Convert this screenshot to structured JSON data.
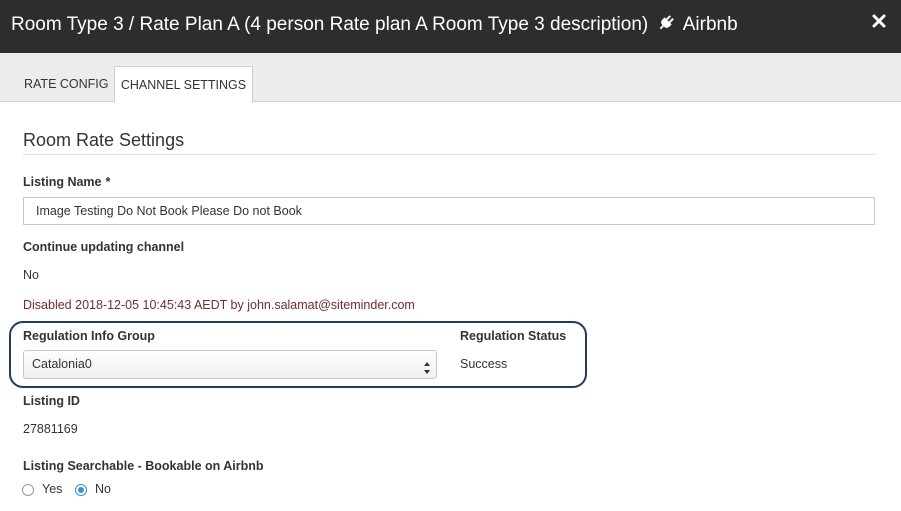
{
  "header": {
    "title": "Room Type 3 / Rate Plan A (4 person Rate plan A Room Type 3 description)",
    "channel": "Airbnb",
    "close_icon": "close-icon",
    "plug_icon": "plug-icon"
  },
  "tabs": [
    {
      "label": "RATE CONFIG",
      "active": false
    },
    {
      "label": "CHANNEL SETTINGS",
      "active": true
    }
  ],
  "section": {
    "title": "Room Rate Settings"
  },
  "listing_name": {
    "label": "Listing Name",
    "required_mark": "*",
    "value": "Image Testing Do Not Book Please Do not Book"
  },
  "continue_updating": {
    "label": "Continue updating channel",
    "value": "No",
    "note": "Disabled 2018-12-05 10:45:43 AEDT by john.salamat@siteminder.com"
  },
  "regulation": {
    "group_label": "Regulation Info Group",
    "group_value": "Catalonia0",
    "status_label": "Regulation Status",
    "status_value": "Success"
  },
  "listing_id": {
    "label": "Listing ID",
    "value": "27881169"
  },
  "searchable": {
    "label": "Listing Searchable - Bookable on Airbnb",
    "options": [
      {
        "label": "Yes",
        "checked": false
      },
      {
        "label": "No",
        "checked": true
      }
    ]
  },
  "colors": {
    "header_bg": "#2d2d2d",
    "highlight_border": "#1f3a6e",
    "note_text": "#7a2a2a",
    "radio_accent": "#3b8ede"
  }
}
